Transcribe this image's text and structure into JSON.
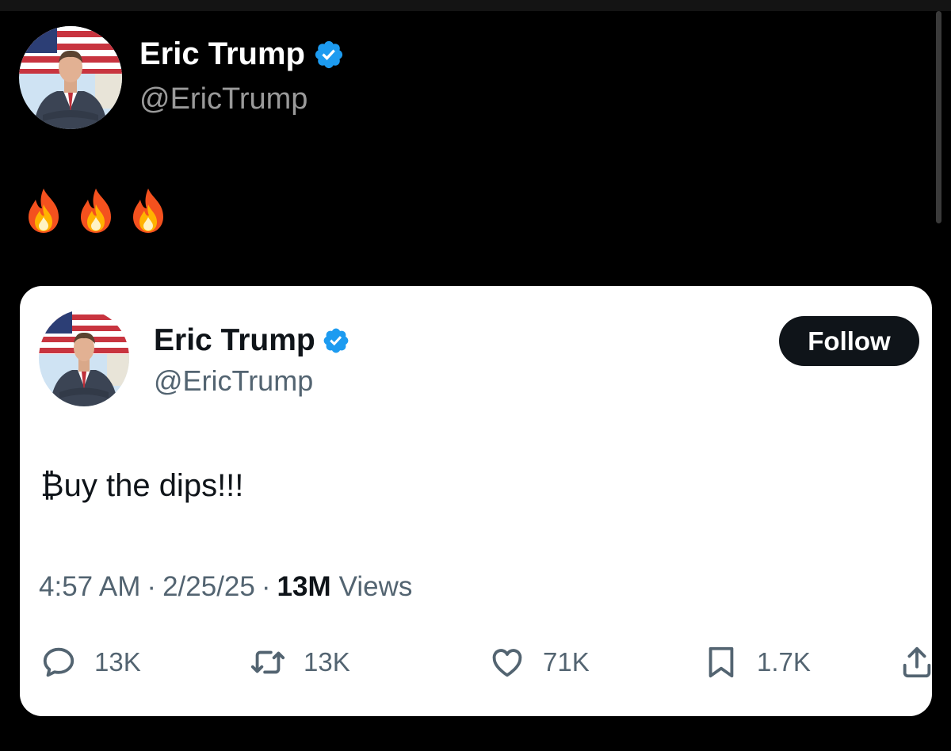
{
  "outer_post": {
    "author_name": "Eric Trump",
    "handle": "@EricTrump",
    "text_emoji": [
      "🔥",
      "🔥",
      "🔥"
    ]
  },
  "quoted_post": {
    "author_name": "Eric Trump",
    "handle": "@EricTrump",
    "follow_label": "Follow",
    "text": "₿uy the dips!!!",
    "time": "4:57 AM",
    "date": "2/25/25",
    "separator": "·",
    "views_count": "13M",
    "views_label": "Views",
    "actions": {
      "replies": "13K",
      "reposts": "13K",
      "likes": "71K",
      "bookmarks": "1.7K"
    }
  },
  "colors": {
    "background": "#000000",
    "card": "#ffffff",
    "verified_badge": "#1d9bf0",
    "secondary_text": "#536471",
    "follow_button": "#0f1419"
  },
  "icons": [
    "verified-badge-icon",
    "fire-emoji",
    "reply-icon",
    "repost-icon",
    "like-icon",
    "bookmark-icon",
    "share-icon"
  ]
}
